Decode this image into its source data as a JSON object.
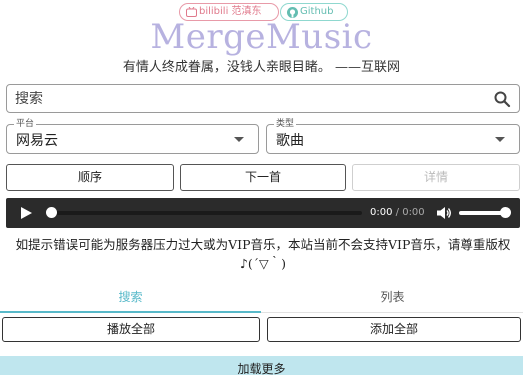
{
  "top_links": {
    "bilibili_label": "bilibili 范滇东",
    "github_label": "Github"
  },
  "app": {
    "title": "MergeMusic",
    "motto": "有情人终成眷属，没钱人亲眼目睹。 ——互联网"
  },
  "search": {
    "placeholder": "搜索",
    "value": ""
  },
  "platform_select": {
    "label": "平台",
    "value": "网易云"
  },
  "type_select": {
    "label": "类型",
    "value": "歌曲"
  },
  "buttons": {
    "order": "顺序",
    "next": "下一首",
    "detail": "详情"
  },
  "player": {
    "current_time": "0:00",
    "separator": " / ",
    "duration": "0:00",
    "progress": 0,
    "volume": 1.0
  },
  "notice": "如提示错误可能为服务器压力过大或为VIP音乐，本站当前不会支持VIP音乐，请尊重版权♪(´▽｀)",
  "tabs": {
    "search_label": "搜索",
    "list_label": "列表",
    "active": "search"
  },
  "actions": {
    "play_all": "播放全部",
    "add_all": "添加全部",
    "load_more": "加载更多"
  },
  "colors": {
    "accent": "#58b9c9",
    "logo": "#b7b2e0",
    "bilibili": "#e07a8c",
    "github": "#64bdb1",
    "player_bg": "#2b2b2b",
    "load_more_bg": "#bfe6ee"
  }
}
